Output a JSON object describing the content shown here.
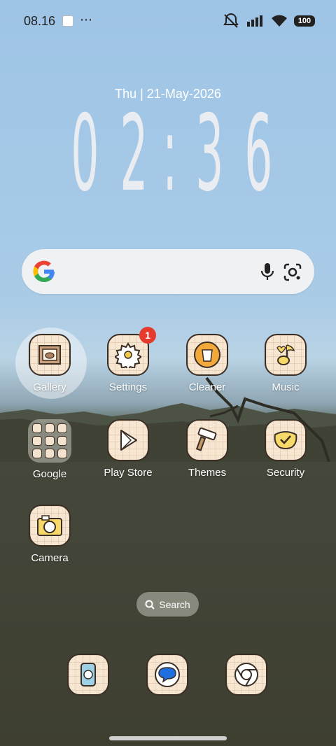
{
  "status_bar": {
    "time": "08.16",
    "more": "⋯",
    "battery": "100",
    "icons": [
      "notification-app-icon",
      "mute-vibrate-icon",
      "signal-icon",
      "wifi-icon",
      "battery-icon"
    ]
  },
  "clock_widget": {
    "date": "Thu | 21-May-2026",
    "h1": "0",
    "h2": "2",
    "colon": ":",
    "m1": "3",
    "m2": "6"
  },
  "search_bar": {
    "icons": [
      "google-logo",
      "mic-icon",
      "google-lens-icon"
    ]
  },
  "apps": [
    {
      "label": "Gallery",
      "icon": "gallery-icon"
    },
    {
      "label": "Settings",
      "icon": "settings-gear-icon",
      "badge": "1"
    },
    {
      "label": "Cleaner",
      "icon": "trash-bin-icon"
    },
    {
      "label": "Music",
      "icon": "music-note-icon"
    },
    {
      "label": "Google",
      "icon": "folder-icon"
    },
    {
      "label": "Play Store",
      "icon": "play-store-icon"
    },
    {
      "label": "Themes",
      "icon": "paint-brush-icon"
    },
    {
      "label": "Security",
      "icon": "shield-check-icon"
    },
    {
      "label": "Camera",
      "icon": "camera-icon"
    }
  ],
  "app_search": {
    "label": "Search",
    "icon": "search-icon"
  },
  "dock": [
    {
      "icon": "phone-icon"
    },
    {
      "icon": "messages-icon"
    },
    {
      "icon": "chrome-icon"
    }
  ],
  "colors": {
    "badge": "#e63a2e",
    "tile": "#f7e6d1",
    "sky": "#9ec4e6",
    "ground": "#3e3f31"
  }
}
